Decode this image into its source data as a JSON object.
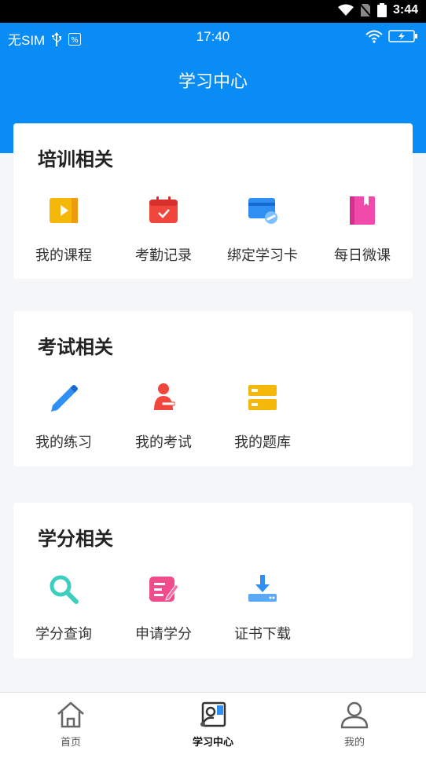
{
  "device_status": {
    "time": "3:44"
  },
  "app_status": {
    "carrier": "无SIM",
    "time": "17:40"
  },
  "header": {
    "title": "学习中心"
  },
  "sections": [
    {
      "title": "培训相关",
      "items": [
        {
          "label": "我的课程",
          "icon": "play-icon"
        },
        {
          "label": "考勤记录",
          "icon": "calendar-icon"
        },
        {
          "label": "绑定学习卡",
          "icon": "card-link-icon"
        },
        {
          "label": "每日微课",
          "icon": "book-icon"
        }
      ]
    },
    {
      "title": "考试相关",
      "items": [
        {
          "label": "我的练习",
          "icon": "pencil-icon"
        },
        {
          "label": "我的考试",
          "icon": "exam-person-icon"
        },
        {
          "label": "我的题库",
          "icon": "database-icon"
        }
      ]
    },
    {
      "title": "学分相关",
      "items": [
        {
          "label": "学分查询",
          "icon": "search-icon"
        },
        {
          "label": "申请学分",
          "icon": "edit-doc-icon"
        },
        {
          "label": "证书下载",
          "icon": "download-icon"
        }
      ]
    }
  ],
  "tabbar": {
    "tabs": [
      {
        "label": "首页",
        "icon": "home-icon"
      },
      {
        "label": "学习中心",
        "icon": "study-icon",
        "active": true
      },
      {
        "label": "我的",
        "icon": "user-icon"
      }
    ]
  },
  "colors": {
    "primary": "#0a8cf6"
  }
}
